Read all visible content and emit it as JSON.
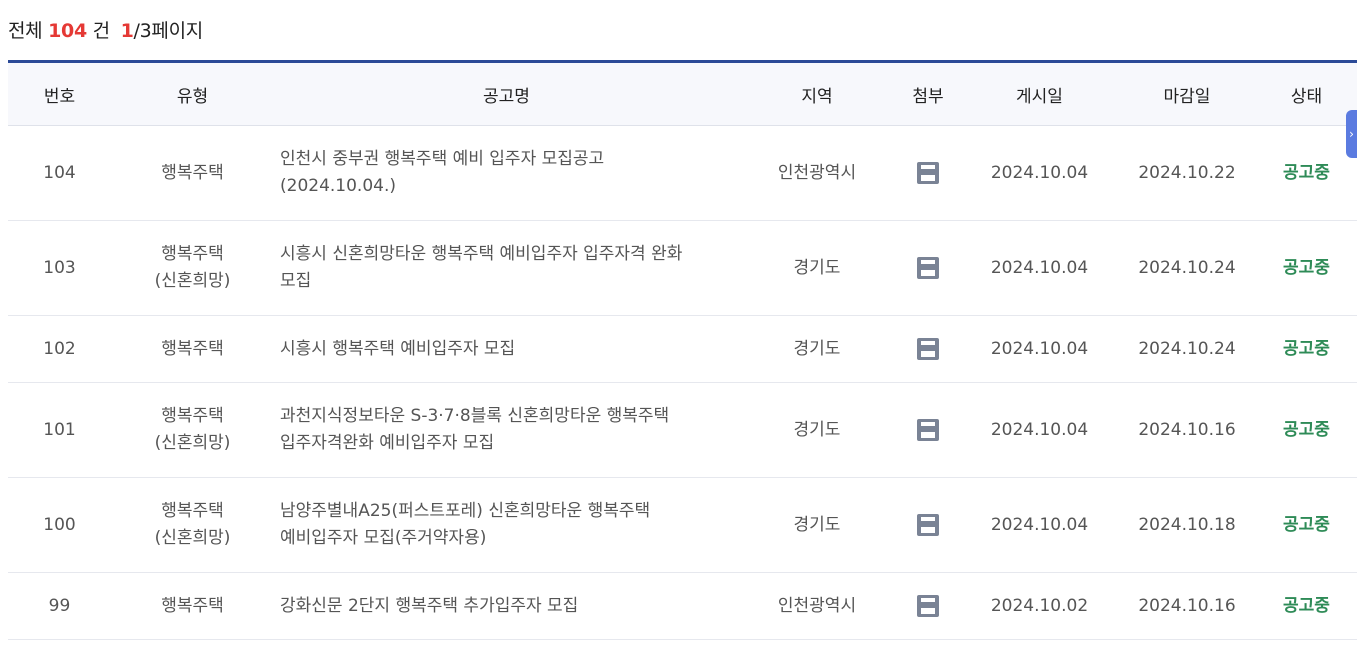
{
  "summary": {
    "prefix": "전체",
    "total": "104",
    "unit": "건",
    "current_page": "1",
    "page_suffix": "/3페이지"
  },
  "table": {
    "headers": [
      "번호",
      "유형",
      "공고명",
      "지역",
      "첨부",
      "게시일",
      "마감일",
      "상태"
    ],
    "rows": [
      {
        "no": "104",
        "type1": "행복주택",
        "type2": "",
        "title1": "인천시 중부권 행복주택 예비 입주자 모집공고",
        "title2": "(2024.10.04.)",
        "region": "인천광역시",
        "attach_icon": "file-icon",
        "posted": "2024.10.04",
        "deadline": "2024.10.22",
        "status": "공고중"
      },
      {
        "no": "103",
        "type1": "행복주택",
        "type2": "(신혼희망)",
        "title1": "시흥시 신혼희망타운 행복주택 예비입주자 입주자격 완화",
        "title2": "모집",
        "region": "경기도",
        "attach_icon": "file-icon",
        "posted": "2024.10.04",
        "deadline": "2024.10.24",
        "status": "공고중"
      },
      {
        "no": "102",
        "type1": "행복주택",
        "type2": "",
        "title1": "시흥시 행복주택 예비입주자 모집",
        "title2": "",
        "region": "경기도",
        "attach_icon": "file-icon",
        "posted": "2024.10.04",
        "deadline": "2024.10.24",
        "status": "공고중"
      },
      {
        "no": "101",
        "type1": "행복주택",
        "type2": "(신혼희망)",
        "title1": "과천지식정보타운 S-3·7·8블록 신혼희망타운 행복주택",
        "title2": "입주자격완화 예비입주자 모집",
        "region": "경기도",
        "attach_icon": "file-icon",
        "posted": "2024.10.04",
        "deadline": "2024.10.16",
        "status": "공고중"
      },
      {
        "no": "100",
        "type1": "행복주택",
        "type2": "(신혼희망)",
        "title1": "남양주별내A25(퍼스트포레) 신혼희망타운 행복주택",
        "title2": "예비입주자 모집(주거약자용)",
        "region": "경기도",
        "attach_icon": "file-icon",
        "posted": "2024.10.04",
        "deadline": "2024.10.18",
        "status": "공고중"
      },
      {
        "no": "99",
        "type1": "행복주택",
        "type2": "",
        "title1": "강화신문 2단지 행복주택 추가입주자 모집",
        "title2": "",
        "region": "인천광역시",
        "attach_icon": "file-icon",
        "posted": "2024.10.02",
        "deadline": "2024.10.16",
        "status": "공고중"
      }
    ]
  },
  "side_tab": {
    "glyph": "›"
  },
  "colors": {
    "accent": "#2b4a97",
    "highlight": "#e53935",
    "status": "#2e8b57",
    "side_tab": "#5b7be0"
  }
}
